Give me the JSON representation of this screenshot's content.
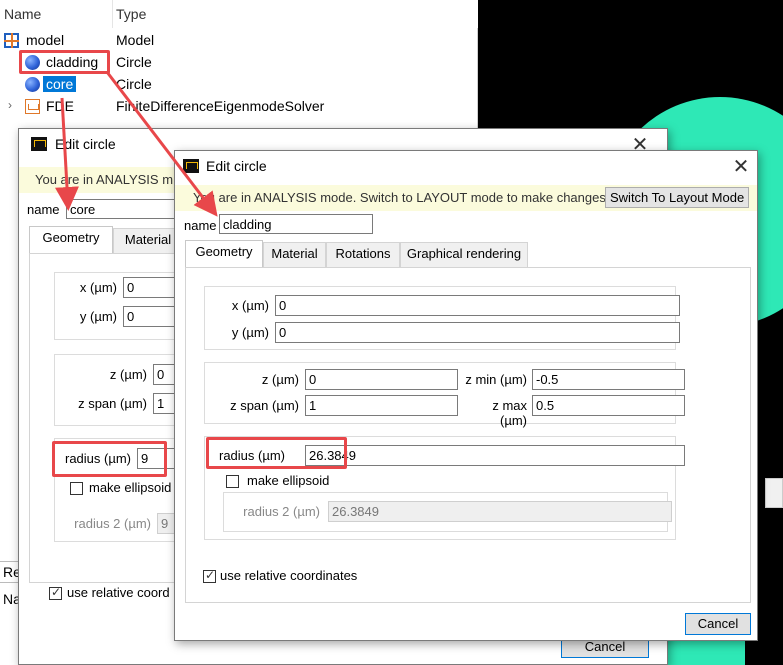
{
  "tree": {
    "columns": [
      "Name",
      "Type"
    ],
    "rows": [
      {
        "name": "model",
        "type": "Model",
        "icon": "model-icon"
      },
      {
        "name": "cladding",
        "type": "Circle",
        "icon": "circle-object-icon"
      },
      {
        "name": "core",
        "type": "Circle",
        "icon": "circle-object-icon"
      },
      {
        "name": "FDE",
        "type": "FiniteDifferenceEigenmodeSolver",
        "icon": "fde-solver-icon"
      }
    ],
    "bottom_items": [
      "Re",
      "Na"
    ]
  },
  "core_dialog": {
    "title": "Edit circle",
    "banner": "You are in ANALYSIS m",
    "name_label": "name",
    "name_value": "core",
    "tabs": [
      "Geometry",
      "Material"
    ],
    "x_label": "x (µm)",
    "x_value": "0",
    "y_label": "y (µm)",
    "y_value": "0",
    "z_label": "z (µm)",
    "z_value": "0",
    "zspan_label": "z span (µm)",
    "zspan_value": "1",
    "radius_label": "radius (µm)",
    "radius_value": "9",
    "ellipsoid_label": "make ellipsoid",
    "radius2_label": "radius 2 (µm)",
    "radius2_value": "9",
    "relative_label": "use relative coord",
    "cancel_label": "Cancel"
  },
  "cladding_dialog": {
    "title": "Edit circle",
    "banner": "You are in ANALYSIS mode.  Switch to LAYOUT mode to make changes:",
    "layout_button": "Switch To Layout Mode",
    "name_label": "name",
    "name_value": "cladding",
    "tabs": [
      "Geometry",
      "Material",
      "Rotations",
      "Graphical rendering"
    ],
    "x_label": "x (µm)",
    "x_value": "0",
    "y_label": "y (µm)",
    "y_value": "0",
    "z_label": "z (µm)",
    "z_value": "0",
    "zspan_label": "z span (µm)",
    "zspan_value": "1",
    "zmin_label": "z min (µm)",
    "zmin_value": "-0.5",
    "zmax_label": "z max (µm)",
    "zmax_value": "0.5",
    "radius_label": "radius (µm)",
    "radius_value": "26.3849",
    "ellipsoid_label": "make ellipsoid",
    "radius2_label": "radius 2 (µm)",
    "radius2_value": "26.3849",
    "relative_label": "use relative coordinates",
    "cancel_label": "Cancel"
  },
  "colors": {
    "highlight": "#e8474a",
    "selection": "#0078d7",
    "banner": "#fbfbdc",
    "accent_teal": "#2ee8b6"
  }
}
